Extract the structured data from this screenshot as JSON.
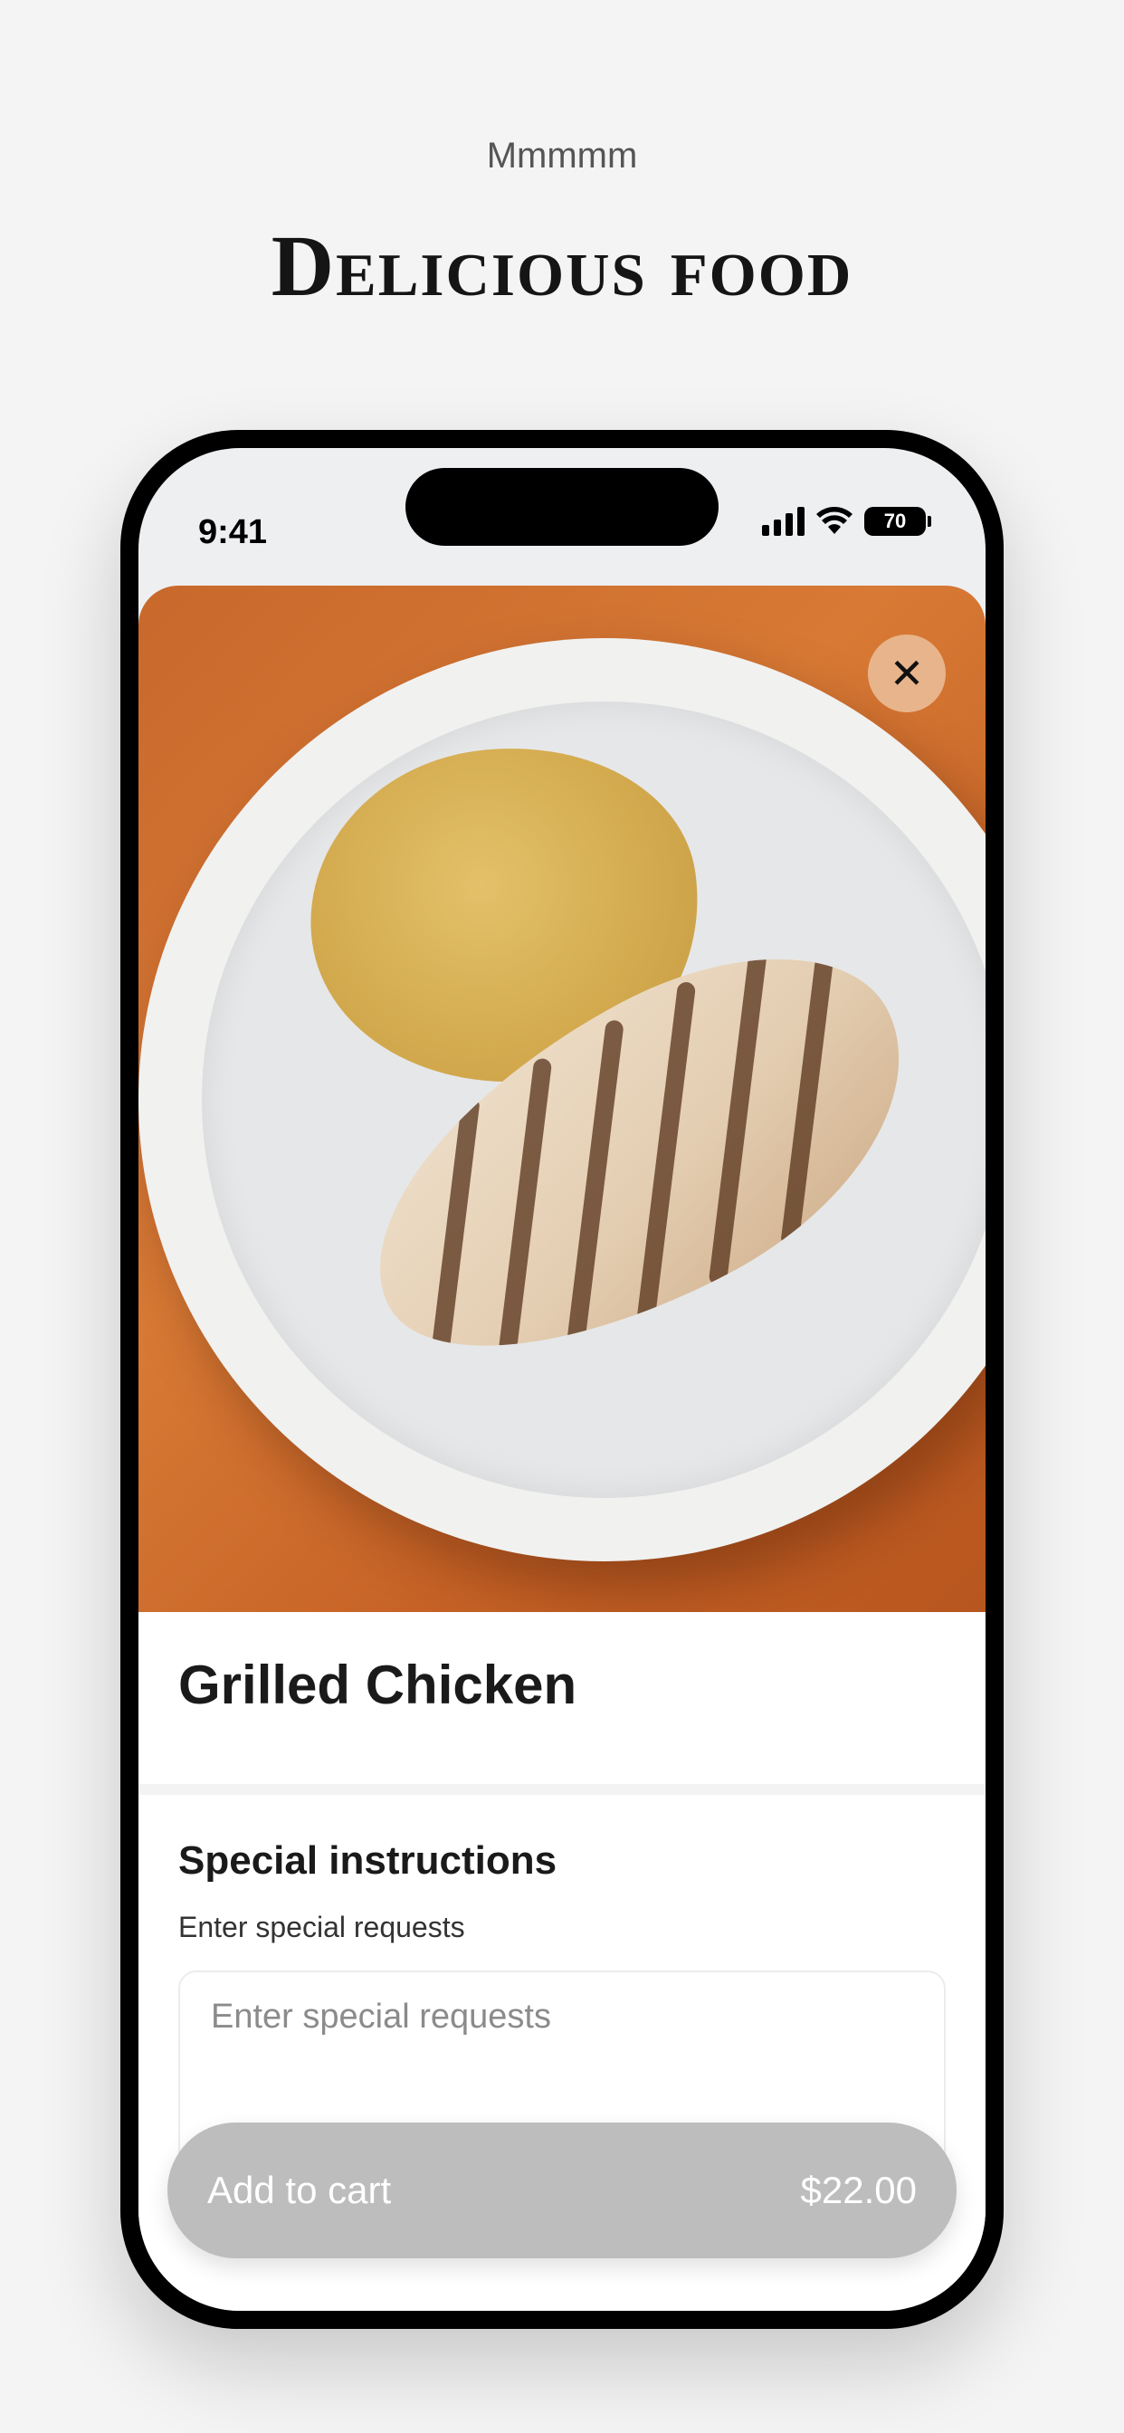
{
  "header": {
    "eyebrow": "Mmmmm",
    "headline": "Delicious food"
  },
  "status_bar": {
    "time": "9:41",
    "battery": "70",
    "icons": [
      "cellular-signal-icon",
      "wifi-icon",
      "battery-icon"
    ]
  },
  "item": {
    "image": "grilled-chicken-photo",
    "title": "Grilled Chicken"
  },
  "instructions": {
    "title": "Special instructions",
    "subtitle": "Enter special requests",
    "placeholder": "Enter special requests"
  },
  "cart": {
    "label": "Add to cart",
    "price": "$22.00"
  },
  "colors": {
    "page_background": "#f4f4f4",
    "close_button": "#e8b48b",
    "cart_button_disabled": "#bdbdbd"
  }
}
